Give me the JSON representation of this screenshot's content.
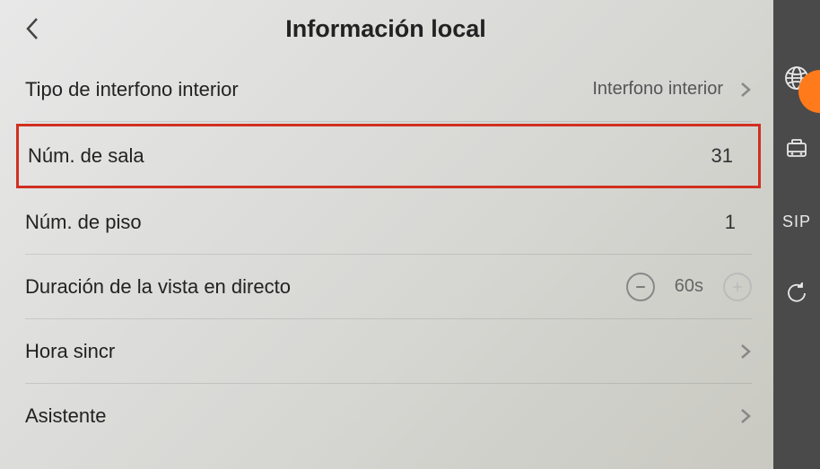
{
  "header": {
    "title": "Información local"
  },
  "rows": {
    "intercom_type": {
      "label": "Tipo de interfono interior",
      "value": "Interfono interior"
    },
    "room_number": {
      "label": "Núm. de sala",
      "value": "31"
    },
    "floor_number": {
      "label": "Núm. de piso",
      "value": "1"
    },
    "live_view_duration": {
      "label": "Duración de la vista en directo",
      "value": "60s"
    },
    "time_sync": {
      "label": "Hora sincr"
    },
    "assistant": {
      "label": "Asistente"
    }
  },
  "sidebar": {
    "sip_label": "SIP"
  }
}
